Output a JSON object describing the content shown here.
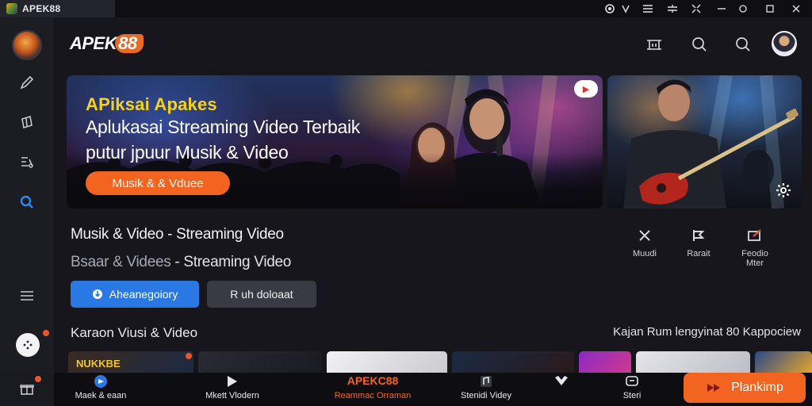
{
  "window": {
    "title": "APEK88",
    "controls": [
      "browser-icon",
      "pin-icon",
      "menu-icon",
      "expand-icon",
      "shrink-icon",
      "minimize-icon",
      "maximize-icon",
      "close-icon"
    ]
  },
  "header": {
    "brand": "APEK",
    "brand_accent": "88",
    "icons": [
      "cast-icon",
      "search-icon",
      "search-icon"
    ]
  },
  "sidebar": {
    "items": [
      "edit-icon",
      "puzzle-icon",
      "list-icon",
      "search-icon",
      "menu-icon"
    ],
    "active_color": "#2a8af0"
  },
  "hero": {
    "line1": "APiksai Apakes",
    "line2": "Aplukasai Streaming Video Terbaik",
    "line3": "putur jpuur Musik & Video",
    "cta": "Musik & & Vduee"
  },
  "section": {
    "title": "Musik & Video - Streaming Video",
    "subtitle_prefix": "Bsaar",
    "subtitle_mid": "& Videes",
    "subtitle_suffix": " - Streaming Video",
    "quick_actions": [
      {
        "label": "Muudi",
        "icon": "music-icon"
      },
      {
        "label": "Rarait",
        "icon": "chart-icon"
      },
      {
        "label": "Feodio Mter",
        "icon": "pen-icon"
      }
    ]
  },
  "buttons": {
    "primary": "Aheanegoiory",
    "secondary": "R uh doloaat"
  },
  "row": {
    "title": "Karaon Viusi & Video",
    "note": "Kajan Rum lengyinat 80 Kappociew",
    "thumbs": [
      "NUKKBE",
      "",
      "",
      "",
      "",
      "",
      ""
    ]
  },
  "bottombar": {
    "items": [
      {
        "label": "Maek & eaan",
        "icon": "home-icon"
      },
      {
        "label": "Mkett Vlodern",
        "icon": "play-icon"
      },
      {
        "label": "Reammac Orraman",
        "icon": "brand-icon"
      },
      {
        "label": "Stenidi Videy",
        "icon": "note-icon"
      },
      {
        "label": "",
        "icon": "heart-icon"
      },
      {
        "label": "Steri",
        "icon": "chat-icon"
      }
    ],
    "center_brand": "APEKC88",
    "cta": "Plankimp"
  },
  "colors": {
    "accent": "#f2641f",
    "primary": "#2a78e4",
    "brand_yellow": "#f6d21e"
  }
}
